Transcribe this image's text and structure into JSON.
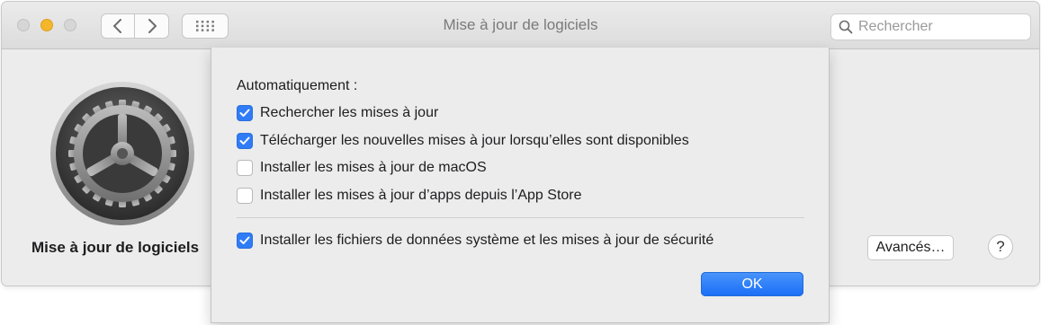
{
  "window": {
    "title": "Mise à jour de logiciels",
    "search_placeholder": "Rechercher"
  },
  "pane": {
    "label": "Mise à jour de logiciels",
    "advanced_button": "Avancés…",
    "help_button": "?"
  },
  "sheet": {
    "heading": "Automatiquement :",
    "options": [
      {
        "label": "Rechercher les mises à jour",
        "checked": true
      },
      {
        "label": "Télécharger les nouvelles mises à jour lorsqu’elles sont disponibles",
        "checked": true
      },
      {
        "label": "Installer les mises à jour de macOS",
        "checked": false
      },
      {
        "label": "Installer les mises à jour d’apps depuis l’App Store",
        "checked": false
      },
      {
        "label": "Installer les fichiers de données système et les mises à jour de sécurité",
        "checked": true
      }
    ],
    "ok_button": "OK"
  },
  "colors": {
    "accent": "#2f7cf6",
    "minimize": "#f4b62a"
  },
  "icons": [
    "back-chevron-icon",
    "forward-chevron-icon",
    "grid-icon",
    "search-icon",
    "software-update-gear-icon",
    "checkmark-icon"
  ]
}
